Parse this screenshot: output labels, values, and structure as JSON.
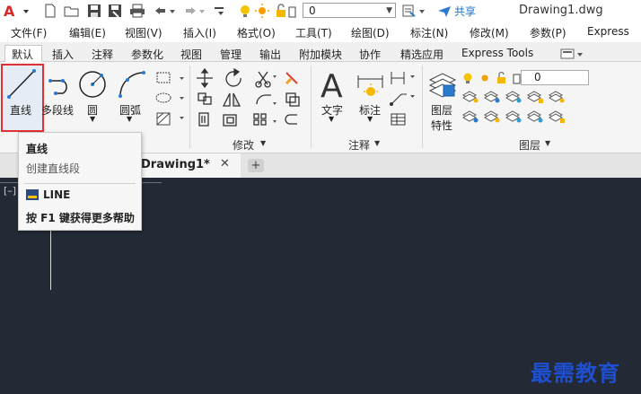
{
  "titlebar": {
    "app_icon": "autocad-logo-icon",
    "layer_value": "0",
    "share_label": "共享",
    "document_title": "Drawing1.dwg"
  },
  "menubar": {
    "items": [
      "文件(F)",
      "编辑(E)",
      "视图(V)",
      "插入(I)",
      "格式(O)",
      "工具(T)",
      "绘图(D)",
      "标注(N)",
      "修改(M)",
      "参数(P)",
      "Express"
    ]
  },
  "ribbon_tabs": {
    "items": [
      "默认",
      "插入",
      "注释",
      "参数化",
      "视图",
      "管理",
      "输出",
      "附加模块",
      "协作",
      "精选应用",
      "Express Tools"
    ],
    "active": "默认"
  },
  "ribbon": {
    "draw": {
      "line": "直线",
      "polyline": "多段线",
      "circle": "圆",
      "arc": "圆弧"
    },
    "modify": {
      "title": "修改"
    },
    "annotation": {
      "text": "文字",
      "dimension": "标注",
      "title": "注释"
    },
    "layers": {
      "properties_line1": "图层",
      "properties_line2": "特性",
      "layer_value": "0",
      "title": "图层"
    }
  },
  "doc_tabs": {
    "active": "Drawing1*",
    "close": "✕",
    "add": "+"
  },
  "canvas": {
    "viewport_control": "[–]"
  },
  "tooltip": {
    "title": "直线",
    "description": "创建直线段",
    "command": "LINE",
    "help": "按 F1 键获得更多帮助"
  },
  "watermark": "最需教育",
  "colors": {
    "accent_red": "#e03030",
    "canvas_bg": "#232a35",
    "share_blue": "#1a73c8",
    "watermark_blue": "#1e4fd0"
  }
}
